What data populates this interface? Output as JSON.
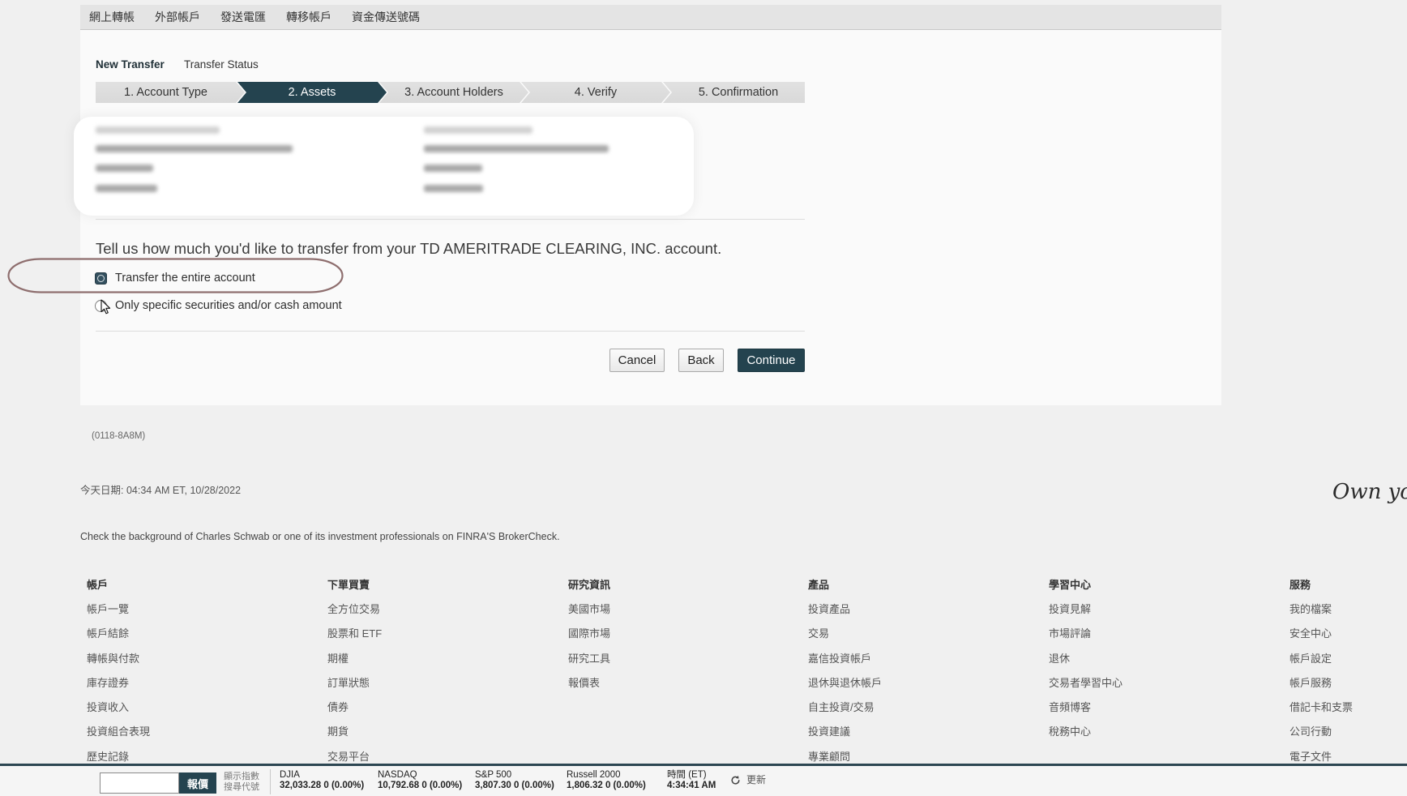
{
  "topnav": {
    "items": [
      "網上轉帳",
      "外部帳戶",
      "發送電匯",
      "轉移帳戶",
      "資金傳送號碼"
    ]
  },
  "subnav": {
    "new_transfer": "New Transfer",
    "transfer_status": "Transfer Status"
  },
  "steps": [
    {
      "label": "1. Account Type",
      "active": false
    },
    {
      "label": "2. Assets",
      "active": true
    },
    {
      "label": "3. Account Holders",
      "active": false
    },
    {
      "label": "4. Verify",
      "active": false
    },
    {
      "label": "5. Confirmation",
      "active": false
    }
  ],
  "form": {
    "question": "Tell us how much you'd like to transfer from your TD AMERITRADE CLEARING, INC. account.",
    "options": [
      {
        "label": "Transfer the entire account",
        "selected": true
      },
      {
        "label": "Only specific securities and/or cash amount",
        "selected": false
      }
    ]
  },
  "buttons": {
    "cancel": "Cancel",
    "back": "Back",
    "continue": "Continue"
  },
  "page_code": "(0118-8A8M)",
  "date_line": "今天日期: 04:34 AM ET, 10/28/2022",
  "tagline": "Own yo",
  "brokercheck_notice": "Check the background of Charles Schwab or one of its investment professionals on FINRA'S BrokerCheck.",
  "footer": {
    "columns": [
      {
        "title": "帳戶",
        "links": [
          "帳戶一覽",
          "帳戶結餘",
          "轉帳與付款",
          "庫存證券",
          "投資收入",
          "投資組合表現",
          "歷史記錄"
        ]
      },
      {
        "title": "下單買賣",
        "links": [
          "全方位交易",
          "股票和 ETF",
          "期權",
          "訂單狀態",
          "債券",
          "期貨",
          "交易平台"
        ]
      },
      {
        "title": "研究資訊",
        "links": [
          "美國市場",
          "國際市場",
          "研究工具",
          "報價表"
        ]
      },
      {
        "title": "產品",
        "links": [
          "投資產品",
          "交易",
          "嘉信投資帳戶",
          "退休與退休帳戶",
          "自主投資/交易",
          "投資建議",
          "專業顧問"
        ]
      },
      {
        "title": "學習中心",
        "links": [
          "投資見解",
          "市場評論",
          "退休",
          "交易者學習中心",
          "音頻博客",
          "稅務中心"
        ]
      },
      {
        "title": "服務",
        "links": [
          "我的檔案",
          "安全中心",
          "帳戶設定",
          "帳戶服務",
          "借記卡和支票",
          "公司行動",
          "電子文件"
        ]
      }
    ]
  },
  "ticker": {
    "quote_button": "報價",
    "show_indices_link": "顯示指數",
    "symbol_lookup_link": "搜尋代號",
    "indices": [
      {
        "name": "DJIA",
        "value": "32,033.28 0 (0.00%)"
      },
      {
        "name": "NASDAQ",
        "value": "10,792.68 0 (0.00%)"
      },
      {
        "name": "S&P 500",
        "value": "3,807.30 0 (0.00%)"
      },
      {
        "name": "Russell 2000",
        "value": "1,806.32 0 (0.00%)"
      }
    ],
    "time_label": "時間 (ET)",
    "time_value": "4:34:41 AM",
    "refresh_label": "更新"
  },
  "icons": {
    "cursor": "mouse-cursor-icon",
    "refresh": "refresh-icon"
  },
  "colors": {
    "page_background": "#f0f0f0",
    "panel_background": "#fafafa",
    "accent": "#24434f",
    "step_inactive": "#d9d9d9",
    "annotation": "#8e6e6e"
  }
}
